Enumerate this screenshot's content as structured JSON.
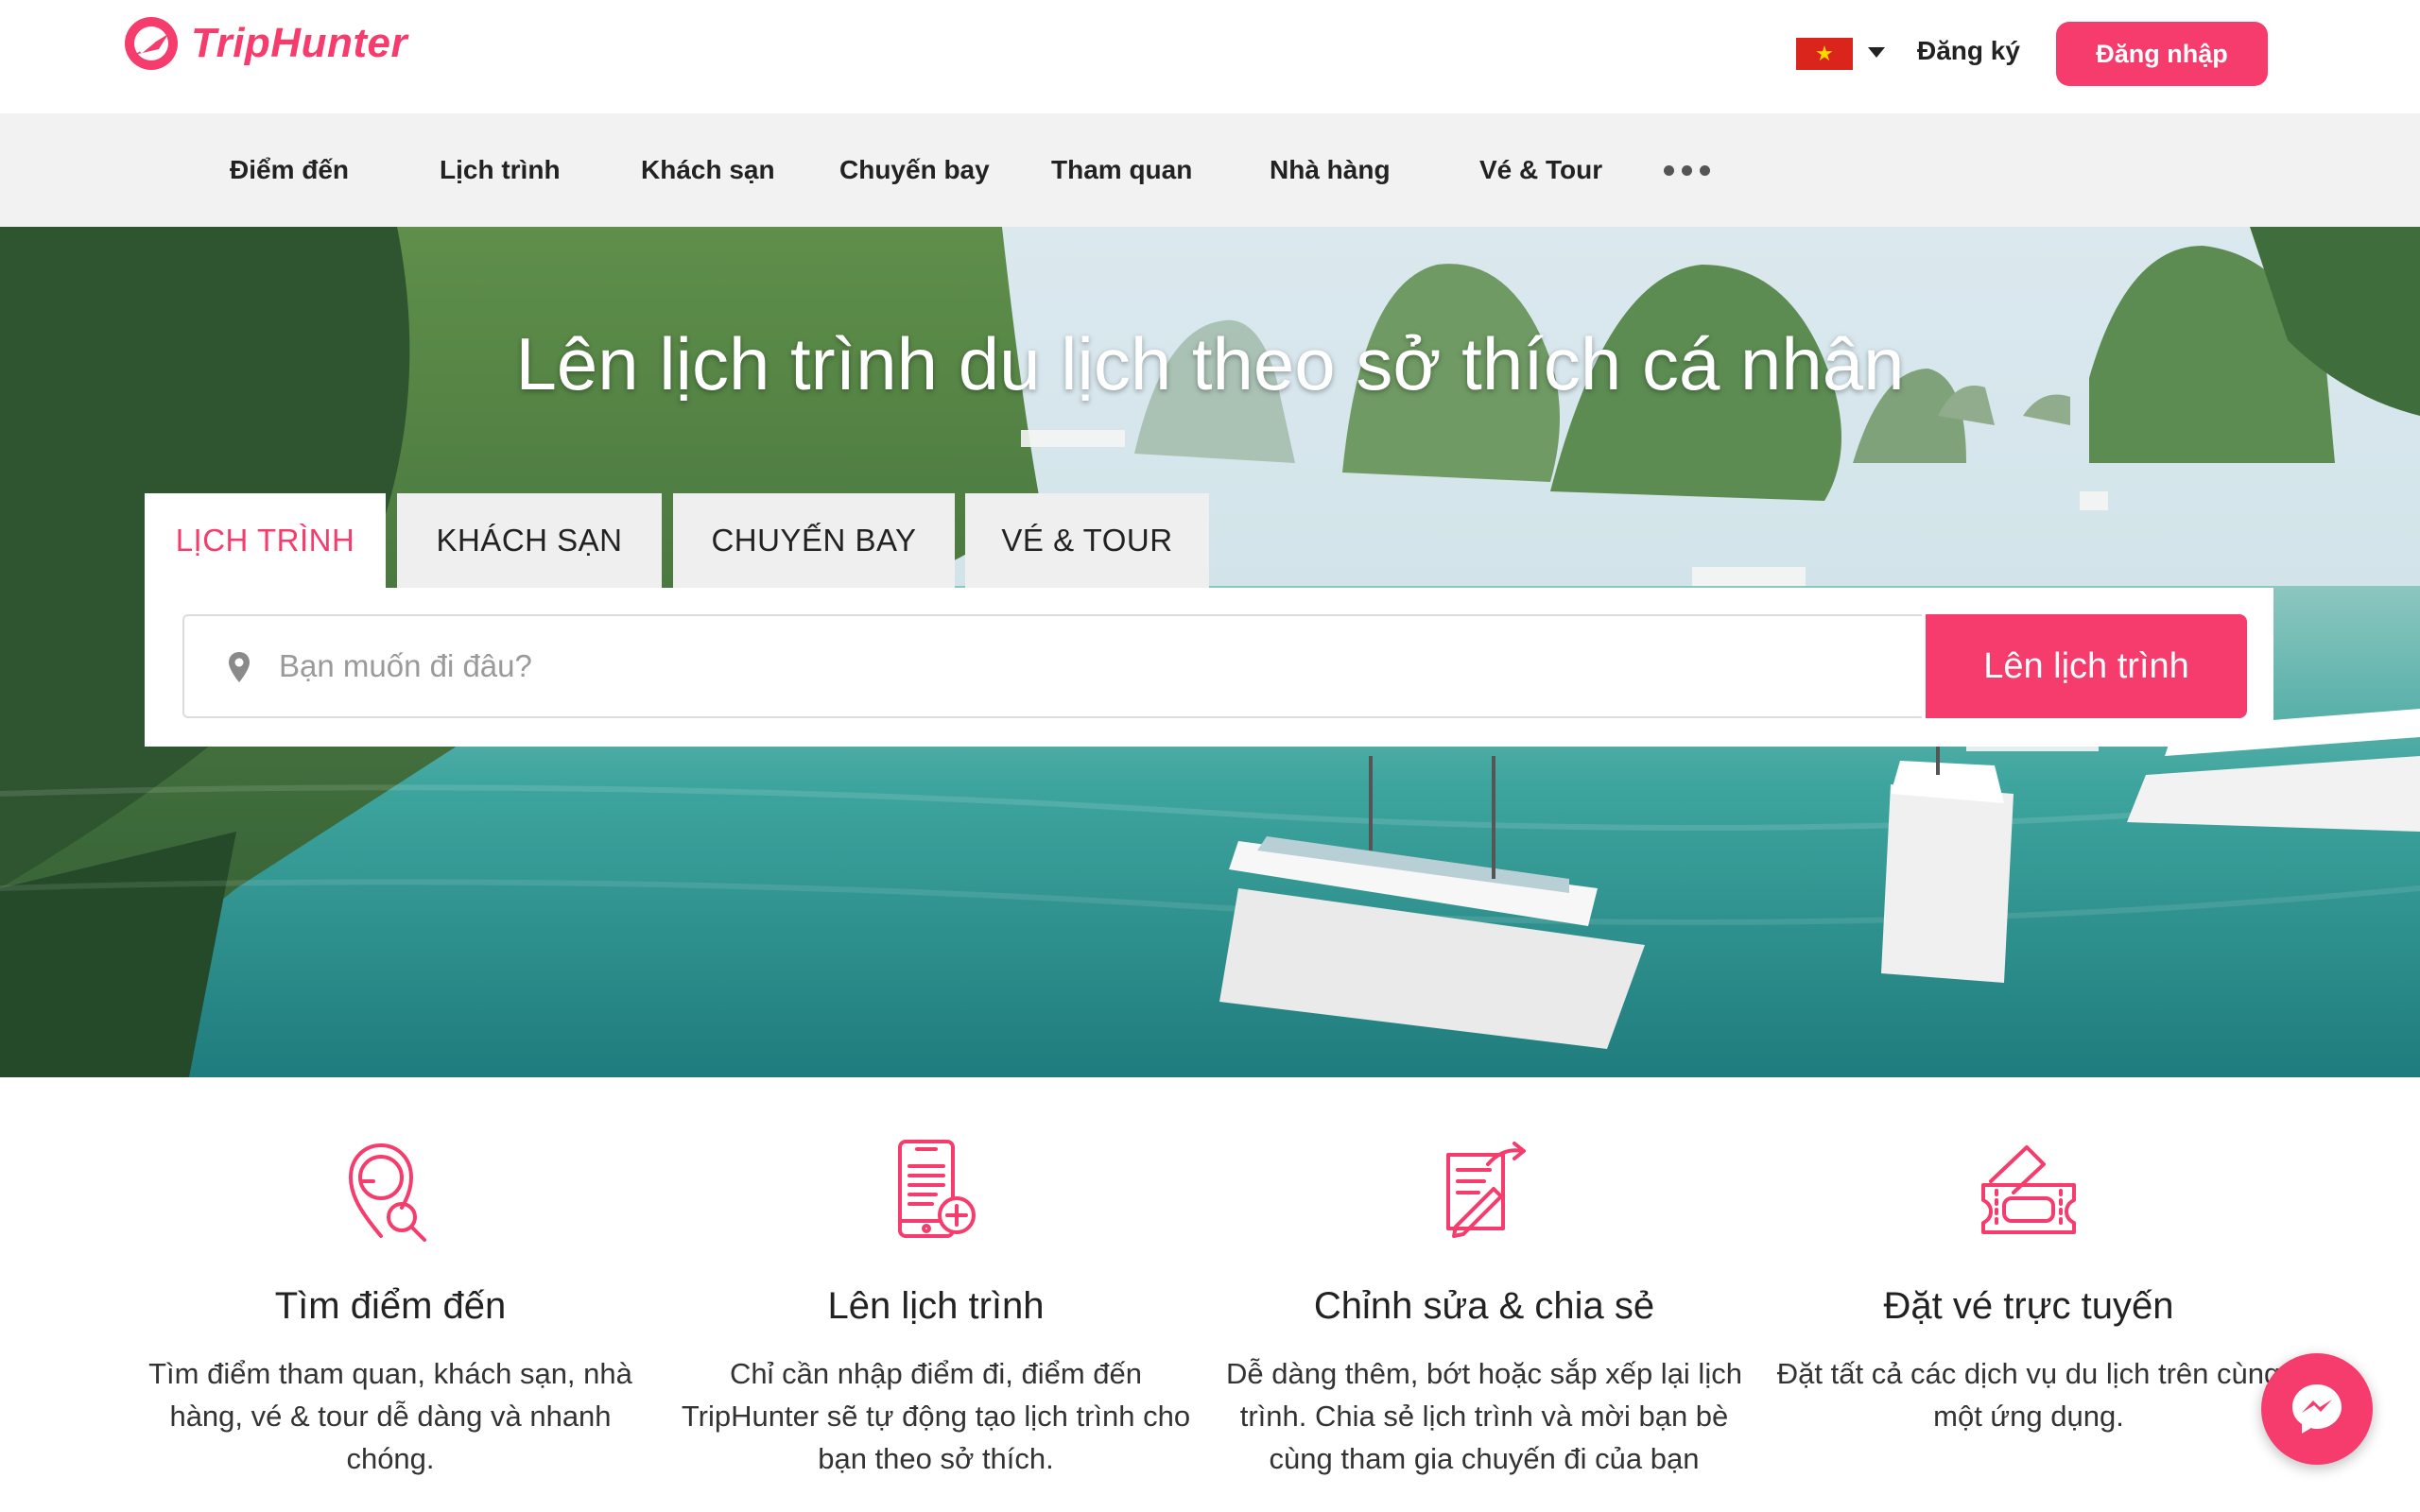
{
  "header": {
    "brand": "TripHunter",
    "language_flag": "★",
    "register_label": "Đăng ký",
    "login_label": "Đăng nhập"
  },
  "nav": {
    "items": [
      "Điểm đến",
      "Lịch trình",
      "Khách sạn",
      "Chuyến bay",
      "Tham quan",
      "Nhà hàng",
      "Vé & Tour"
    ],
    "more_icon": "ellipsis-icon"
  },
  "hero": {
    "title": "Lên lịch trình du lịch theo sở thích cá nhân",
    "tabs": [
      "LỊCH TRÌNH",
      "KHÁCH SẠN",
      "CHUYẾN BAY",
      "VÉ & TOUR"
    ],
    "active_tab": "LỊCH TRÌNH",
    "search_placeholder": "Bạn muốn đi đâu?",
    "search_value": "",
    "submit_label": "Lên lịch trình"
  },
  "features": [
    {
      "icon": "location-search-icon",
      "title": "Tìm điểm đến",
      "desc": "Tìm điểm tham quan, khách sạn, nhà hàng, vé & tour dễ dàng và nhanh chóng."
    },
    {
      "icon": "phone-plan-icon",
      "title": "Lên lịch trình",
      "desc": "Chỉ cần nhập điểm đi, điểm đến TripHunter sẽ tự động tạo lịch trình cho bạn theo sở thích."
    },
    {
      "icon": "edit-share-icon",
      "title": "Chỉnh sửa & chia sẻ",
      "desc": "Dễ dàng thêm, bớt hoặc sắp xếp lại lịch trình. Chia sẻ lịch trình và mời bạn bè cùng tham gia chuyến đi của bạn"
    },
    {
      "icon": "ticket-icon",
      "title": "Đặt vé trực tuyến",
      "desc": "Đặt tất cả các dịch vụ du lịch trên cùng một ứng dụng."
    }
  ],
  "colors": {
    "accent": "#f53c6c",
    "nav_bg": "#f2f2f2"
  },
  "messenger_icon": "messenger-icon"
}
